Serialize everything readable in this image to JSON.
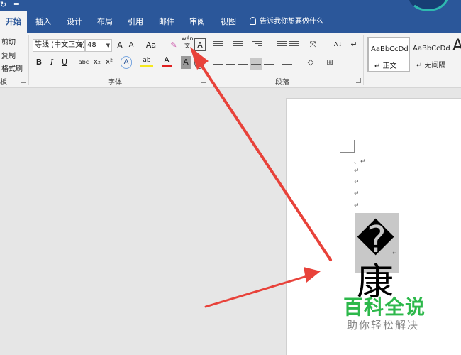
{
  "quick_access": {
    "redo": "↻",
    "customize": "≡"
  },
  "tabs": [
    "开始",
    "插入",
    "设计",
    "布局",
    "引用",
    "邮件",
    "审阅",
    "视图"
  ],
  "tell_me": "告诉我你想要做什么",
  "clipboard": {
    "cut": "剪切",
    "copy": "复制",
    "format_painter": "格式刷",
    "label": "板"
  },
  "font": {
    "label": "字体",
    "name": "等线 (中文正文)",
    "size": "48",
    "grow": "A",
    "shrink": "A",
    "case": "Aa",
    "phonetic_top": "wén",
    "phonetic_bottom": "文",
    "border_char": "A",
    "bold": "B",
    "italic": "I",
    "underline": "U",
    "strike": "abc",
    "subscript": "x₂",
    "superscript": "x²",
    "text_effect": "A",
    "highlight": "ab",
    "font_color": "A",
    "char_shade": "A"
  },
  "paragraph": {
    "label": "段落",
    "sort": "A↓",
    "show_marks": "↵"
  },
  "styles": [
    {
      "sample": "AaBbCcDd",
      "name": "↵ 正文"
    },
    {
      "sample": "AaBbCcDd",
      "name": "↵ 无间隔"
    },
    {
      "sample": "A"
    }
  ],
  "document": {
    "paragraph_marks": [
      "、↵",
      "↵",
      "↵",
      "↵",
      "↵"
    ],
    "character": "�康",
    "char_mark": "↵"
  },
  "watermark": {
    "title": "百科全说",
    "subtitle": "助你轻松解决"
  },
  "colors": {
    "title_bar": "#2b579a",
    "ribbon": "#f3f3f3",
    "workspace": "#e6e6e6",
    "arrow": "#e8423a",
    "watermark_green": "#2db84b"
  }
}
